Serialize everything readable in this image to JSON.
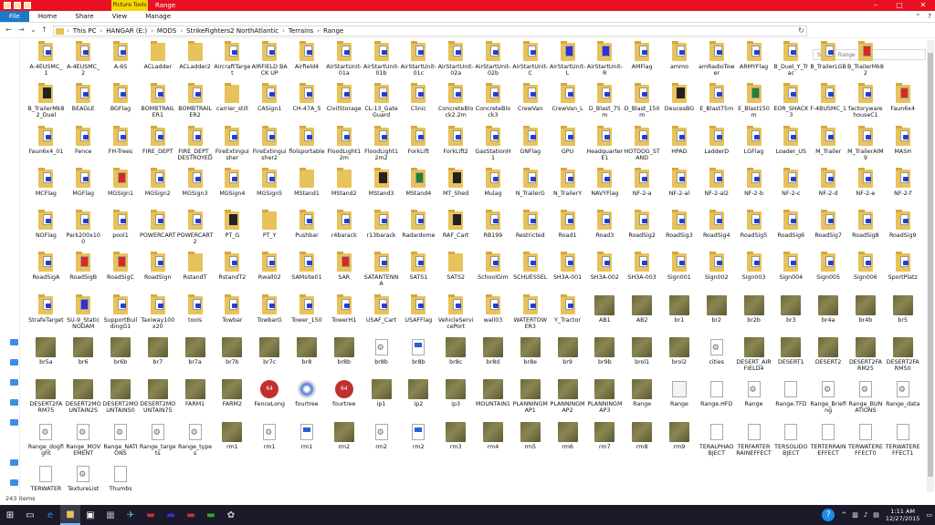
{
  "titlebar": {
    "context_tab": "Picture Tools",
    "title": "Range",
    "minimize": "–",
    "maximize": "▢",
    "close": "✕"
  },
  "ribbon": {
    "file": "File",
    "home": "Home",
    "share": "Share",
    "view": "View",
    "manage": "Manage",
    "collapse": "⌃",
    "help": "?"
  },
  "nav": {
    "back": "←",
    "forward": "→",
    "history": "⌄",
    "up": "↑",
    "refresh": "↻"
  },
  "breadcrumb": [
    "This PC",
    "HANGAR (E:)",
    "MODS",
    "StrikeFighters2 NorthAtlantic",
    "Terrains",
    "Range"
  ],
  "search": {
    "placeholder": "Search Range"
  },
  "status": {
    "items": "243 items"
  },
  "clock": {
    "time": "1:11 AM",
    "date": "12/27/2015"
  },
  "colors": {
    "titlebar": "#e81123",
    "context_tab": "#f7d600",
    "file_tab": "#1979ca",
    "taskbar": "#1a1a2a"
  },
  "items": [
    {
      "n": "A-4EUSMC_1",
      "t": "fb"
    },
    {
      "n": "A-4EUSMC_2",
      "t": "fb"
    },
    {
      "n": "A-6S",
      "t": "fb"
    },
    {
      "n": "ACLadder",
      "t": "f"
    },
    {
      "n": "ACLadder2",
      "t": "f"
    },
    {
      "n": "AircraftTarget",
      "t": "fb"
    },
    {
      "n": "AIRFIELD BACK UP",
      "t": "fb"
    },
    {
      "n": "Airfield4",
      "t": "fb"
    },
    {
      "n": "AirStartUnit-01a",
      "t": "fb"
    },
    {
      "n": "AirStartUnit-01b",
      "t": "fb"
    },
    {
      "n": "AirStartUnit-01c",
      "t": "fb"
    },
    {
      "n": "AirStartUnit-02a",
      "t": "fb"
    },
    {
      "n": "AirStartUnit-02b",
      "t": "fb"
    },
    {
      "n": "AirStartUnit-C",
      "t": "fb"
    },
    {
      "n": "AirStartUnit-L",
      "t": "fu"
    },
    {
      "n": "AirStartUnit-R",
      "t": "fu"
    },
    {
      "n": "AMFlag",
      "t": "fb"
    },
    {
      "n": "ammo",
      "t": "fb"
    },
    {
      "n": "amRadioTower",
      "t": "fb"
    },
    {
      "n": "ARMYFlag",
      "t": "fb"
    },
    {
      "n": "B_Duel_Y_Trac",
      "t": "fb"
    },
    {
      "n": "B_TrailerLGB",
      "t": "fb"
    },
    {
      "n": "B_TrailerMk82",
      "t": "fr"
    },
    {
      "n": "",
      "t": "e"
    },
    {
      "n": "B_TrailerMk82_Duel",
      "t": "fd"
    },
    {
      "n": "BEAGLE",
      "t": "fb"
    },
    {
      "n": "BGFlag",
      "t": "fb"
    },
    {
      "n": "BOMBTRAILER1",
      "t": "fb"
    },
    {
      "n": "BOMBTRAILER2",
      "t": "fb"
    },
    {
      "n": "carrier_still",
      "t": "f"
    },
    {
      "n": "CASign1",
      "t": "fb"
    },
    {
      "n": "CH-47A_S",
      "t": "fb"
    },
    {
      "n": "CivilStorage",
      "t": "fb"
    },
    {
      "n": "CL-13_GateGuard",
      "t": "fb"
    },
    {
      "n": "Clinic",
      "t": "fb"
    },
    {
      "n": "ConcreteBlock2.2m",
      "t": "fb"
    },
    {
      "n": "ConcreteBlock3",
      "t": "fb"
    },
    {
      "n": "CrewVan",
      "t": "fb"
    },
    {
      "n": "CrewVan_L",
      "t": "fb"
    },
    {
      "n": "D_Blast_75m",
      "t": "fb"
    },
    {
      "n": "D_Blast_150m",
      "t": "fb"
    },
    {
      "n": "DeucesBG",
      "t": "fd"
    },
    {
      "n": "E_Blast75m",
      "t": "fb"
    },
    {
      "n": "E_Blast150m",
      "t": "fg"
    },
    {
      "n": "EOR_SHACK3",
      "t": "fb"
    },
    {
      "n": "F-4BUSMC_1",
      "t": "fb"
    },
    {
      "n": "factorywarehouseC1",
      "t": "fb"
    },
    {
      "n": "Faun6x4",
      "t": "fr"
    },
    {
      "n": "Faun6x4_01",
      "t": "fb"
    },
    {
      "n": "Fence",
      "t": "fb"
    },
    {
      "n": "FH-Trees",
      "t": "fb"
    },
    {
      "n": "FIRE_DEPT",
      "t": "fb"
    },
    {
      "n": "FIRE_DEPT_DESTROYED",
      "t": "fb"
    },
    {
      "n": "FireExtinguisher",
      "t": "fb"
    },
    {
      "n": "FireExtinguisher2",
      "t": "fb"
    },
    {
      "n": "flolsportable",
      "t": "fb"
    },
    {
      "n": "FloodLight12m",
      "t": "fb"
    },
    {
      "n": "FloodLight12m2",
      "t": "fb"
    },
    {
      "n": "ForkLift",
      "t": "fb"
    },
    {
      "n": "ForkLift2",
      "t": "fb"
    },
    {
      "n": "GasStationH1",
      "t": "fb"
    },
    {
      "n": "GNFlag",
      "t": "fb"
    },
    {
      "n": "GPU",
      "t": "fb"
    },
    {
      "n": "HeadquarterE1",
      "t": "fb"
    },
    {
      "n": "HOTDOG_STAND",
      "t": "fb"
    },
    {
      "n": "HPAD",
      "t": "fb"
    },
    {
      "n": "LadderD",
      "t": "fb"
    },
    {
      "n": "LGFlag",
      "t": "fb"
    },
    {
      "n": "Loader_US",
      "t": "fb"
    },
    {
      "n": "M_Trailer",
      "t": "fb"
    },
    {
      "n": "M_TrailerAIM9",
      "t": "fb"
    },
    {
      "n": "MASH",
      "t": "fb"
    },
    {
      "n": "MCFlag",
      "t": "fb"
    },
    {
      "n": "MGFlag",
      "t": "fb"
    },
    {
      "n": "MGSign1",
      "t": "fr"
    },
    {
      "n": "MGSign2",
      "t": "fb"
    },
    {
      "n": "MGSign3",
      "t": "fb"
    },
    {
      "n": "MGSign4",
      "t": "fb"
    },
    {
      "n": "MGSign5",
      "t": "fb"
    },
    {
      "n": "MStand1",
      "t": "f"
    },
    {
      "n": "MStand2",
      "t": "f"
    },
    {
      "n": "MStand3",
      "t": "fd"
    },
    {
      "n": "MStand4",
      "t": "fg"
    },
    {
      "n": "MT_Shed",
      "t": "fd"
    },
    {
      "n": "Mulag",
      "t": "fb"
    },
    {
      "n": "N_TrailerG",
      "t": "fb"
    },
    {
      "n": "N_TrailerY",
      "t": "fb"
    },
    {
      "n": "NAVYFlag",
      "t": "fb"
    },
    {
      "n": "NF-2-a",
      "t": "fb"
    },
    {
      "n": "NF-2-al",
      "t": "fb"
    },
    {
      "n": "NF-2-al2",
      "t": "fb"
    },
    {
      "n": "NF-2-b",
      "t": "fb"
    },
    {
      "n": "NF-2-c",
      "t": "fb"
    },
    {
      "n": "NF-2-d",
      "t": "fb"
    },
    {
      "n": "NF-2-e",
      "t": "fb"
    },
    {
      "n": "NF-2-f",
      "t": "fb"
    },
    {
      "n": "NOFlag",
      "t": "fb"
    },
    {
      "n": "Park200x100",
      "t": "fb"
    },
    {
      "n": "pool1",
      "t": "fb"
    },
    {
      "n": "POWERCART",
      "t": "fb"
    },
    {
      "n": "POWERCART2",
      "t": "fb"
    },
    {
      "n": "PT_G",
      "t": "fd"
    },
    {
      "n": "PT_Y",
      "t": "f"
    },
    {
      "n": "Pushbar",
      "t": "fb"
    },
    {
      "n": "r4barack",
      "t": "fb"
    },
    {
      "n": "r13barack",
      "t": "fb"
    },
    {
      "n": "Radardome",
      "t": "fb"
    },
    {
      "n": "RAF_Cart",
      "t": "fd"
    },
    {
      "n": "RB199",
      "t": "fb"
    },
    {
      "n": "Restricted",
      "t": "fb"
    },
    {
      "n": "Road1",
      "t": "fb"
    },
    {
      "n": "Road3",
      "t": "fb"
    },
    {
      "n": "RoadSig2",
      "t": "fb"
    },
    {
      "n": "RoadSig3",
      "t": "fb"
    },
    {
      "n": "RoadSig4",
      "t": "fb"
    },
    {
      "n": "RoadSig5",
      "t": "fb"
    },
    {
      "n": "RoadSig6",
      "t": "fb"
    },
    {
      "n": "RoadSig7",
      "t": "fb"
    },
    {
      "n": "RoadSig8",
      "t": "fb"
    },
    {
      "n": "RoadSig9",
      "t": "fb"
    },
    {
      "n": "RoadSigA",
      "t": "fb"
    },
    {
      "n": "RoadSigB",
      "t": "fr"
    },
    {
      "n": "RoadSigC",
      "t": "fr"
    },
    {
      "n": "RoadSign",
      "t": "fb"
    },
    {
      "n": "RstandT",
      "t": "f"
    },
    {
      "n": "RstandT2",
      "t": "fb"
    },
    {
      "n": "Rwall02",
      "t": "fb"
    },
    {
      "n": "SAMsite01",
      "t": "fb"
    },
    {
      "n": "SAR",
      "t": "fr"
    },
    {
      "n": "SATANTENNA",
      "t": "fb"
    },
    {
      "n": "SATS1",
      "t": "fb"
    },
    {
      "n": "SATS2",
      "t": "f"
    },
    {
      "n": "SchoolGim",
      "t": "fb"
    },
    {
      "n": "SCHUESSEL",
      "t": "fb"
    },
    {
      "n": "SH3A-001",
      "t": "fb"
    },
    {
      "n": "SH3A-002",
      "t": "fb"
    },
    {
      "n": "SH3A-003",
      "t": "fb"
    },
    {
      "n": "Sign001",
      "t": "fb"
    },
    {
      "n": "Sign002",
      "t": "fb"
    },
    {
      "n": "Sign003",
      "t": "fb"
    },
    {
      "n": "Sign004",
      "t": "fb"
    },
    {
      "n": "Sign005",
      "t": "fb"
    },
    {
      "n": "Sign006",
      "t": "fb"
    },
    {
      "n": "SportPlatz",
      "t": "fb"
    },
    {
      "n": "StrafeTarget",
      "t": "fb"
    },
    {
      "n": "SU-9_StaticNODAM",
      "t": "fu"
    },
    {
      "n": "SupportBuildingG1",
      "t": "fb"
    },
    {
      "n": "Taxiway100x20",
      "t": "fb"
    },
    {
      "n": "tools",
      "t": "fb"
    },
    {
      "n": "Towbar",
      "t": "fb"
    },
    {
      "n": "TowbarG",
      "t": "fb"
    },
    {
      "n": "Tower_150",
      "t": "fb"
    },
    {
      "n": "TowerH1",
      "t": "fb"
    },
    {
      "n": "USAF_Cart",
      "t": "fb"
    },
    {
      "n": "USAFFlag",
      "t": "fb"
    },
    {
      "n": "VehicleServicePort",
      "t": "fb"
    },
    {
      "n": "wall03",
      "t": "fb"
    },
    {
      "n": "WATERTOWER3",
      "t": "fb"
    },
    {
      "n": "Y_Tractor",
      "t": "fb"
    },
    {
      "n": "AB1",
      "t": "i"
    },
    {
      "n": "AB2",
      "t": "i"
    },
    {
      "n": "br1",
      "t": "i"
    },
    {
      "n": "br2",
      "t": "i"
    },
    {
      "n": "br2b",
      "t": "i"
    },
    {
      "n": "br3",
      "t": "i"
    },
    {
      "n": "br4a",
      "t": "i"
    },
    {
      "n": "br4b",
      "t": "i"
    },
    {
      "n": "br5",
      "t": "i"
    },
    {
      "n": "br5a",
      "t": "i"
    },
    {
      "n": "br6",
      "t": "i"
    },
    {
      "n": "br6b",
      "t": "i"
    },
    {
      "n": "br7",
      "t": "i"
    },
    {
      "n": "br7a",
      "t": "i"
    },
    {
      "n": "br7b",
      "t": "i"
    },
    {
      "n": "br7c",
      "t": "i"
    },
    {
      "n": "br8",
      "t": "i"
    },
    {
      "n": "br8b",
      "t": "i"
    },
    {
      "n": "br8b",
      "t": "c"
    },
    {
      "n": "br8b",
      "t": "w"
    },
    {
      "n": "br8c",
      "t": "i"
    },
    {
      "n": "br8d",
      "t": "i"
    },
    {
      "n": "br8e",
      "t": "i"
    },
    {
      "n": "br9",
      "t": "i"
    },
    {
      "n": "br9b",
      "t": "i"
    },
    {
      "n": "brol1",
      "t": "i"
    },
    {
      "n": "brol2",
      "t": "i"
    },
    {
      "n": "cities",
      "t": "c"
    },
    {
      "n": "DESERT_AIRFIELD4",
      "t": "i"
    },
    {
      "n": "DESERT1",
      "t": "i"
    },
    {
      "n": "DESERT2",
      "t": "i"
    },
    {
      "n": "DESERT2FARM25",
      "t": "i"
    },
    {
      "n": "DESERT2FARM50",
      "t": "i"
    },
    {
      "n": "DESERT2FARM75",
      "t": "i"
    },
    {
      "n": "DESERT2MOUNTAIN2S",
      "t": "i"
    },
    {
      "n": "DESERT2MOUNTAINS0",
      "t": "i"
    },
    {
      "n": "DESERT2MOUNTAIN75",
      "t": "i"
    },
    {
      "n": "FARM1",
      "t": "i"
    },
    {
      "n": "FARM2",
      "t": "i"
    },
    {
      "n": "FenceLong",
      "t": "p"
    },
    {
      "n": "fourtree",
      "t": "d"
    },
    {
      "n": "fourtree",
      "t": "p"
    },
    {
      "n": "ip1",
      "t": "i"
    },
    {
      "n": "ip2",
      "t": "i"
    },
    {
      "n": "ip3",
      "t": "i"
    },
    {
      "n": "MOUNTAIN1",
      "t": "i"
    },
    {
      "n": "PLANNINGMAP1",
      "t": "i"
    },
    {
      "n": "PLANNINGMAP2",
      "t": "i"
    },
    {
      "n": "PLANNINGMAP3",
      "t": "i"
    },
    {
      "n": "Range",
      "t": "i"
    },
    {
      "n": "Range",
      "t": "n"
    },
    {
      "n": "Range.HFD",
      "t": "b"
    },
    {
      "n": "Range",
      "t": "c"
    },
    {
      "n": "Range.TFD",
      "t": "b"
    },
    {
      "n": "Range_Briefing",
      "t": "c"
    },
    {
      "n": "Range_BUNATIONS",
      "t": "c"
    },
    {
      "n": "Range_data",
      "t": "c"
    },
    {
      "n": "Range_dogfight",
      "t": "c"
    },
    {
      "n": "Range_MOVEMENT",
      "t": "c"
    },
    {
      "n": "Range_NATIONS",
      "t": "c"
    },
    {
      "n": "Range_targets",
      "t": "c"
    },
    {
      "n": "Range_types",
      "t": "c"
    },
    {
      "n": "rm1",
      "t": "i"
    },
    {
      "n": "rm1",
      "t": "c"
    },
    {
      "n": "rm1",
      "t": "w"
    },
    {
      "n": "rm2",
      "t": "i"
    },
    {
      "n": "rm2",
      "t": "c"
    },
    {
      "n": "rm2",
      "t": "w"
    },
    {
      "n": "rm3",
      "t": "i"
    },
    {
      "n": "rm4",
      "t": "i"
    },
    {
      "n": "rm5",
      "t": "i"
    },
    {
      "n": "rm6",
      "t": "i"
    },
    {
      "n": "rm7",
      "t": "i"
    },
    {
      "n": "rm8",
      "t": "i"
    },
    {
      "n": "rm9",
      "t": "i"
    },
    {
      "n": "TERALPHAOBJECT",
      "t": "b"
    },
    {
      "n": "TERFARTERRAINEFFECT",
      "t": "b"
    },
    {
      "n": "TERSOLIDOBJECT",
      "t": "b"
    },
    {
      "n": "TERTERRAINEFFECT",
      "t": "b"
    },
    {
      "n": "TERWATEREFFECT0",
      "t": "b"
    },
    {
      "n": "TERWATEREFFECT1",
      "t": "b"
    },
    {
      "n": "TERWATER",
      "t": "b"
    },
    {
      "n": "TextureList",
      "t": "c"
    },
    {
      "n": "Thumbs",
      "t": "b"
    }
  ]
}
